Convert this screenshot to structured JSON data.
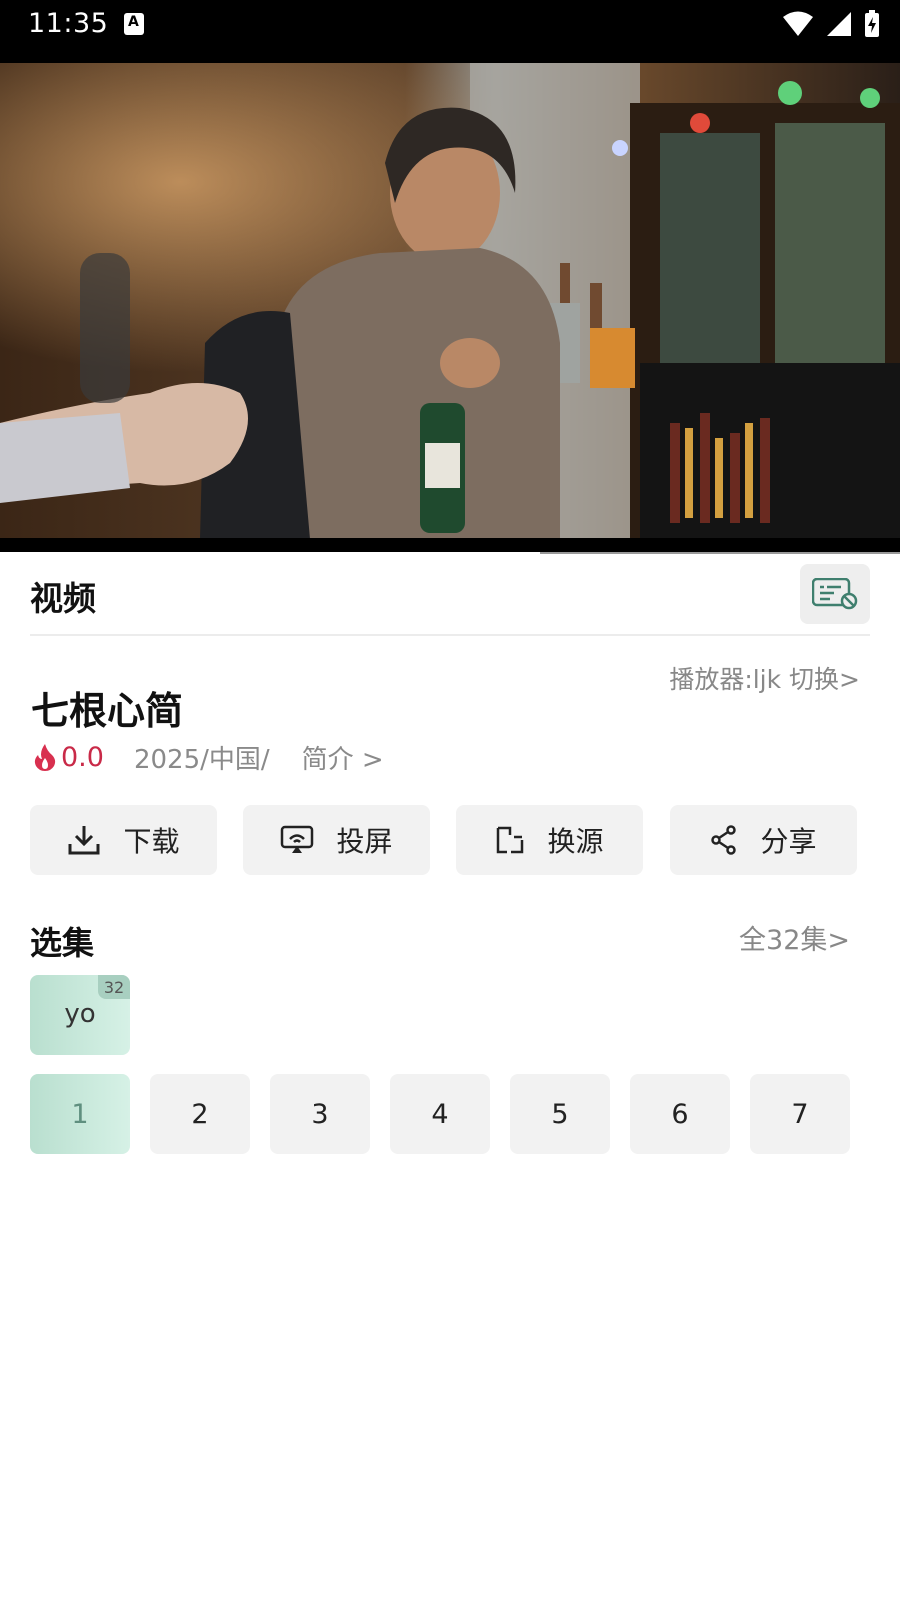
{
  "status": {
    "time": "11:35",
    "notif_letter": "A"
  },
  "video": {
    "progress": 0.6
  },
  "section": {
    "title": "视频"
  },
  "detail": {
    "player_switch": "播放器:ljk 切换>",
    "title": "七根心简",
    "score": "0.0",
    "meta": "2025/中国/",
    "intro": "简介 >"
  },
  "actions": [
    {
      "label": "下载",
      "icon": "download-icon"
    },
    {
      "label": "投屏",
      "icon": "cast-icon"
    },
    {
      "label": "换源",
      "icon": "switch-source-icon"
    },
    {
      "label": "分享",
      "icon": "share-icon"
    }
  ],
  "episodes": {
    "title": "选集",
    "all_label": "全32集>",
    "source": {
      "label": "yo",
      "count": "32"
    },
    "items": [
      "1",
      "2",
      "3",
      "4",
      "5",
      "6",
      "7"
    ],
    "active_index": 0
  },
  "colors": {
    "score": "#c92a48",
    "active_chip": "#c8e8da"
  }
}
